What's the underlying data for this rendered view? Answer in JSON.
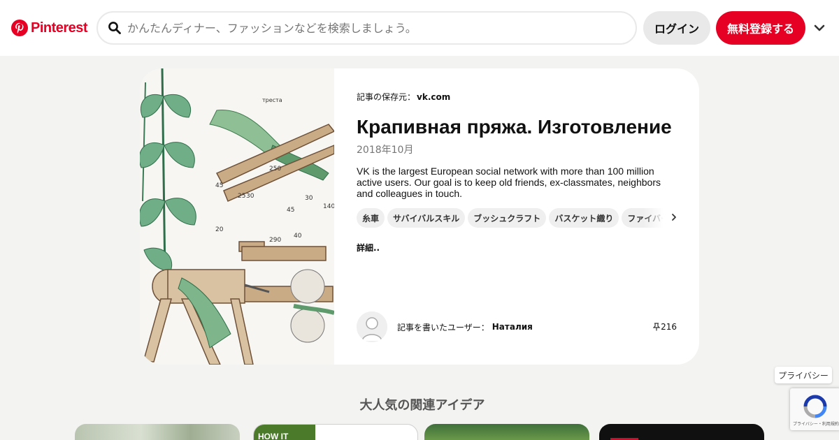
{
  "header": {
    "brand": "Pinterest",
    "search_placeholder": "かんたんディナー、ファッションなどを検索しましょう。",
    "login_label": "ログイン",
    "signup_label": "無料登録する"
  },
  "pin": {
    "source_prefix": "記事の保存元：",
    "source_domain": "vk.com",
    "title": "Крапивная пряжа. Изготовление",
    "date": "2018年10月",
    "description": "VK is the largest European social network with more than 100 million active users. Our goal is to keep old friends, ex-classmates, neighbors and colleagues in touch.",
    "tags": [
      "糸車",
      "サバイバルスキル",
      "ブッシュクラフト",
      "バスケット織り",
      "ファイバー"
    ],
    "more_label": "詳細..",
    "author_prefix": "記事を書いたユーザー：",
    "author_name": "Наталия",
    "pin_count": "216",
    "image": {
      "caption": "треста",
      "dimensions": [
        "250",
        "45",
        "25",
        "30",
        "30",
        "45",
        "140",
        "20",
        "290",
        "40"
      ]
    }
  },
  "privacy_label": "プライバシー",
  "related": {
    "title": "大人気の関連アイデア",
    "card2_text": "HOW IT WORKS"
  },
  "recaptcha": {
    "caption": "プライバシー・利用規約"
  },
  "colors": {
    "brand": "#e60023",
    "background": "#f3f3f1",
    "chip": "#efefef"
  },
  "icons": [
    "pinterest-logo-icon",
    "search-icon",
    "chevron-down-icon",
    "chevron-right-icon",
    "pin-icon",
    "user-avatar-icon",
    "recaptcha-icon"
  ]
}
